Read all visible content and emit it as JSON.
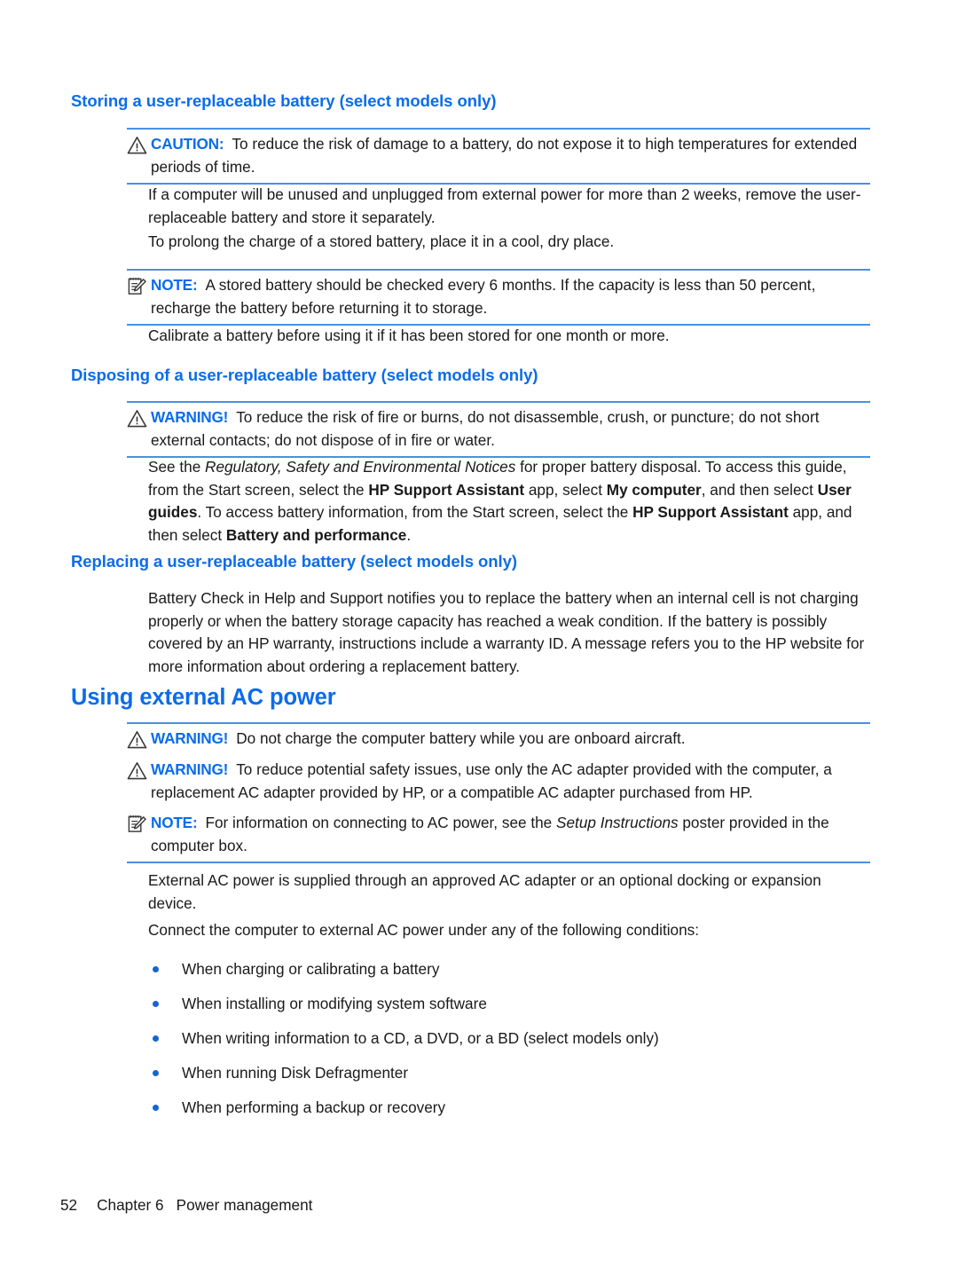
{
  "document": {
    "headings": {
      "storing": "Storing a user-replaceable battery (select models only)",
      "disposing": "Disposing of a user-replaceable battery (select models only)",
      "replacing": "Replacing a user-replaceable battery (select models only)",
      "using_ac": "Using external AC power"
    },
    "callouts": {
      "caution_storing": {
        "icon": "caution-triangle-icon",
        "label": "CAUTION:",
        "text": "To reduce the risk of damage to a battery, do not expose it to high temperatures for extended periods of time."
      },
      "note_storing": {
        "icon": "note-pad-icon",
        "label": "NOTE:",
        "text": "A stored battery should be checked every 6 months. If the capacity is less than 50 percent, recharge the battery before returning it to storage."
      },
      "warning_disposing": {
        "icon": "warning-triangle-icon",
        "label": "WARNING!",
        "text": "To reduce the risk of fire or burns, do not disassemble, crush, or puncture; do not short external contacts; do not dispose of in fire or water."
      },
      "warning_aircraft": {
        "icon": "warning-triangle-icon",
        "label": "WARNING!",
        "text": "Do not charge the computer battery while you are onboard aircraft."
      },
      "warning_adapter": {
        "icon": "warning-triangle-icon",
        "label": "WARNING!",
        "text": "To reduce potential safety issues, use only the AC adapter provided with the computer, a replacement AC adapter provided by HP, or a compatible AC adapter purchased from HP."
      },
      "note_setup": {
        "icon": "note-pad-icon",
        "label": "NOTE:",
        "text_before": "For information on connecting to AC power, see the ",
        "text_italic": "Setup Instructions",
        "text_after": " poster provided in the computer box."
      }
    },
    "paragraphs": {
      "unused_unplugged": "If a computer will be unused and unplugged from external power for more than 2 weeks, remove the user-replaceable battery and store it separately.",
      "prolong_charge": "To prolong the charge of a stored battery, place it in a cool, dry place.",
      "calibrate": "Calibrate a battery before using it if it has been stored for one month or more.",
      "regulatory": {
        "s1": "See the ",
        "i1": "Regulatory, Safety and Environmental Notices",
        "s2": " for proper battery disposal. To access this guide, from the Start screen, select the ",
        "b1": "HP Support Assistant",
        "s3": " app, select ",
        "b2": "My computer",
        "s4": ", and then select ",
        "b3": "User guides",
        "s5": ". To access battery information, from the Start screen, select the ",
        "b4": "HP Support Assistant",
        "s6": " app, and then select ",
        "b5": "Battery and performance",
        "s7": "."
      },
      "battery_check": "Battery Check in Help and Support notifies you to replace the battery when an internal cell is not charging properly or when the battery storage capacity has reached a weak condition. If the battery is possibly covered by an HP warranty, instructions include a warranty ID. A message refers you to the HP website for more information about ordering a replacement battery.",
      "external_ac_supplied": "External AC power is supplied through an approved AC adapter or an optional docking or expansion device.",
      "connect_conditions": "Connect the computer to external AC power under any of the following conditions:"
    },
    "bullets": [
      "When charging or calibrating a battery",
      "When installing or modifying system software",
      "When writing information to a CD, a DVD, or a BD (select models only)",
      "When running Disk Defragmenter",
      "When performing a backup or recovery"
    ],
    "footer": {
      "page_number": "52",
      "chapter": "Chapter 6",
      "chapter_title": "Power management"
    },
    "colors": {
      "heading_blue": "#0a6ceb",
      "rule_blue": "#4a90e2",
      "bullet_blue": "#1464d2",
      "body_text": "#1a1a1a"
    }
  }
}
